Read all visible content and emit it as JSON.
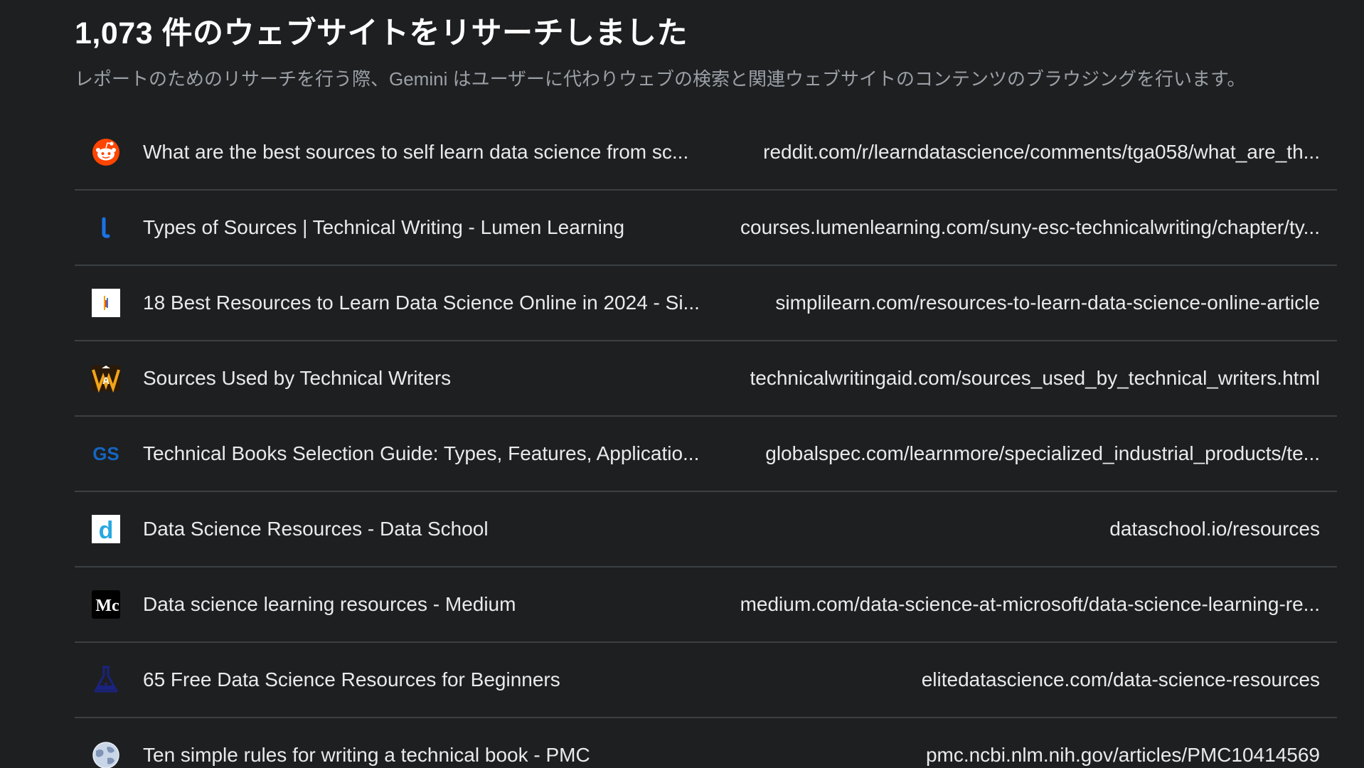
{
  "header": {
    "title": "1,073 件のウェブサイトをリサーチしました",
    "subtitle": "レポートのためのリサーチを行う際、Gemini はユーザーに代わりウェブの検索と関連ウェブサイトのコンテンツのブラウジングを行います。"
  },
  "sources": [
    {
      "title": "What are the best sources to self learn data science from sc...",
      "url": "reddit.com/r/learndatascience/comments/tga058/what_are_th...",
      "icon": "reddit-icon"
    },
    {
      "title": "Types of Sources | Technical Writing - Lumen Learning",
      "url": "courses.lumenlearning.com/suny-esc-technicalwriting/chapter/ty...",
      "icon": "lumen-learning-icon"
    },
    {
      "title": "18 Best Resources to Learn Data Science Online in 2024 - Si...",
      "url": "simplilearn.com/resources-to-learn-data-science-online-article",
      "icon": "simplilearn-icon"
    },
    {
      "title": "Sources Used by Technical Writers",
      "url": "technicalwritingaid.com/sources_used_by_technical_writers.html",
      "icon": "technicalwritingaid-icon"
    },
    {
      "title": "Technical Books Selection Guide: Types, Features, Applicatio...",
      "url": "globalspec.com/learnmore/specialized_industrial_products/te...",
      "icon": "globalspec-icon",
      "icon_text": "GS"
    },
    {
      "title": "Data Science Resources - Data School",
      "url": "dataschool.io/resources",
      "icon": "dataschool-icon",
      "icon_text": "d"
    },
    {
      "title": "Data science learning resources - Medium",
      "url": "medium.com/data-science-at-microsoft/data-science-learning-re...",
      "icon": "medium-icon",
      "icon_text": "Mc"
    },
    {
      "title": "65 Free Data Science Resources for Beginners",
      "url": "elitedatascience.com/data-science-resources",
      "icon": "elitedatascience-flask-icon"
    },
    {
      "title": "Ten simple rules for writing a technical book - PMC",
      "url": "pmc.ncbi.nlm.nih.gov/articles/PMC10414569",
      "icon": "globe-icon"
    }
  ],
  "colors": {
    "background": "#1e1f21",
    "divider": "#3c4043",
    "subtitle": "#9aa0a6",
    "reddit": "#ff4500",
    "lumen": "#1a73e8",
    "globalspec": "#1565c0",
    "dataschool": "#29a8e0",
    "elite": "#1a237e"
  }
}
